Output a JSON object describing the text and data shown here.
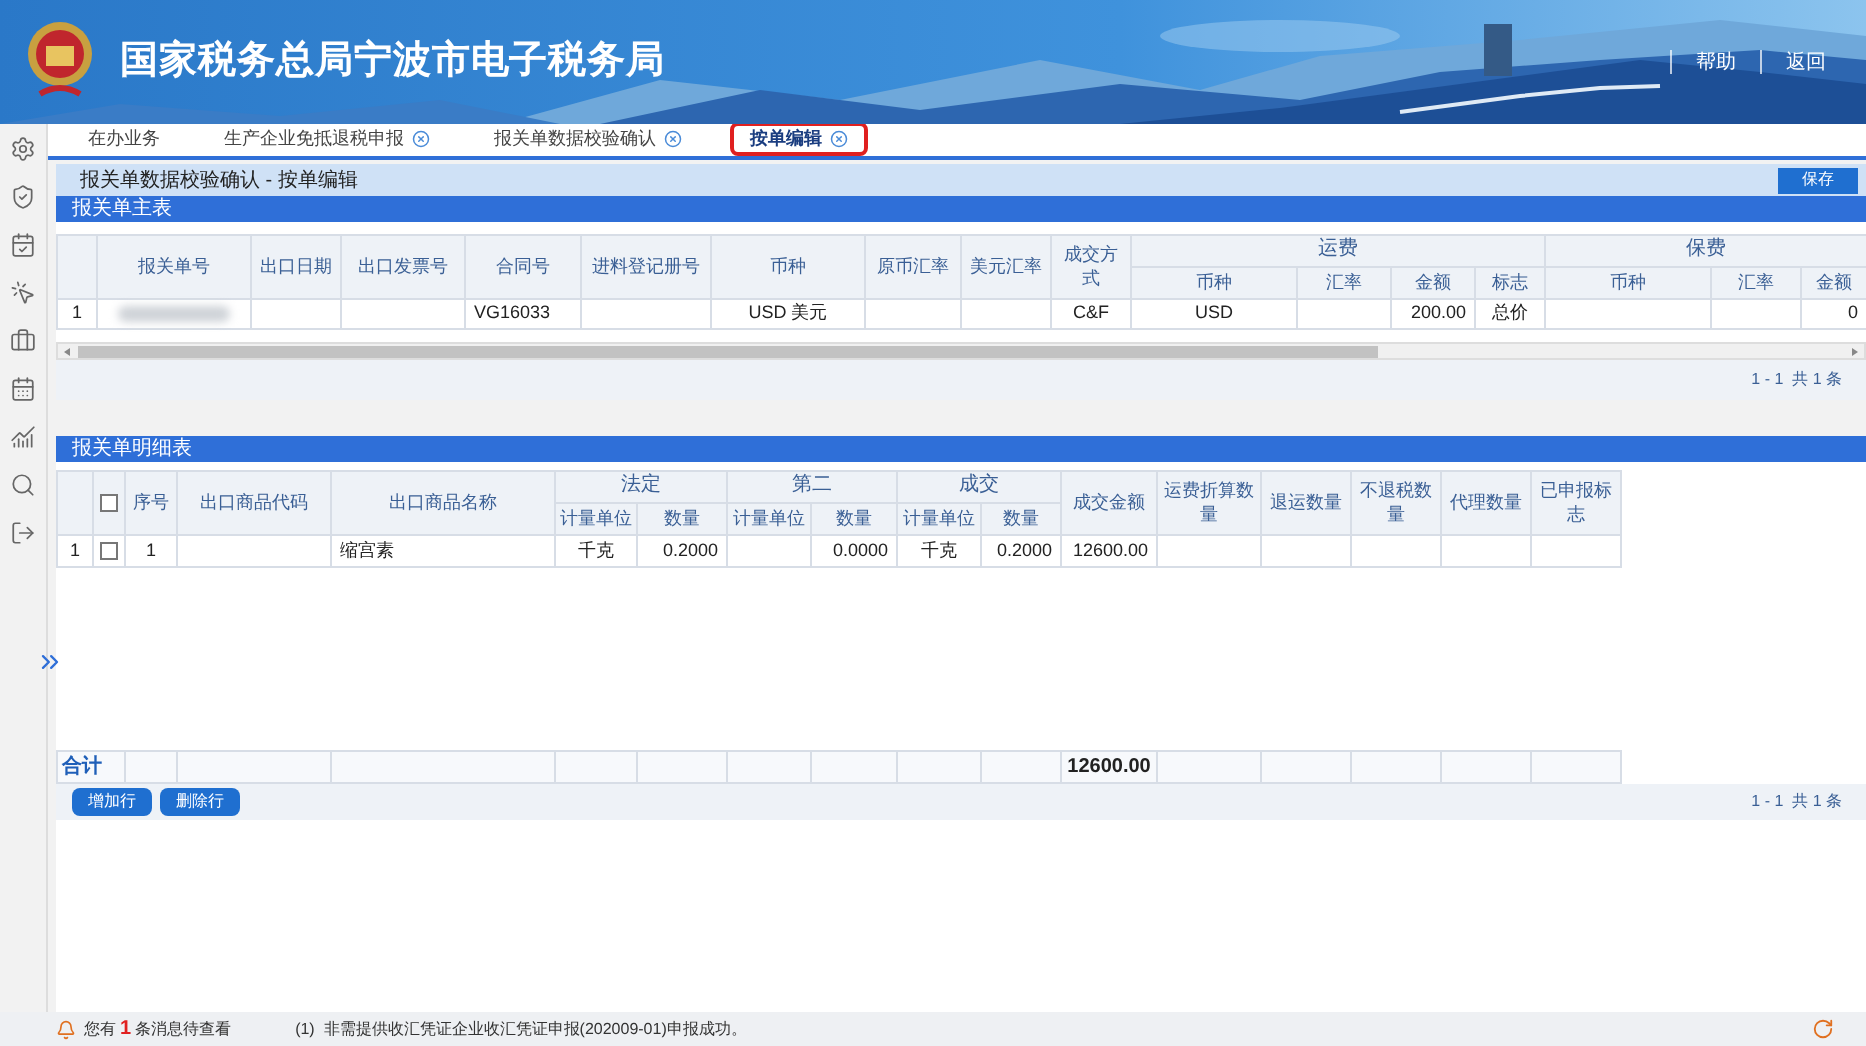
{
  "header": {
    "title": "国家税务总局宁波市电子税务局",
    "links": [
      "帮助",
      "返回"
    ]
  },
  "tabs": [
    {
      "label": "在办业务",
      "selected": false,
      "closable": false
    },
    {
      "label": "生产企业免抵退税申报",
      "selected": false,
      "closable": true
    },
    {
      "label": "报关单数据校验确认",
      "selected": false,
      "closable": true
    },
    {
      "label": "按单编辑",
      "selected": true,
      "closable": true
    }
  ],
  "page": {
    "title": "报关单数据校验确认 - 按单编辑",
    "save_button": "保存"
  },
  "main_table": {
    "title": "报关单主表",
    "columns": [
      {},
      {
        "label": "报关单号"
      },
      {
        "label": "出口日期"
      },
      {
        "label": "出口发票号"
      },
      {
        "label": "合同号"
      },
      {
        "label": "进料登记册号"
      },
      {
        "label": "币种"
      },
      {
        "label": "原币汇率"
      },
      {
        "label": "美元汇率"
      },
      {
        "label": "成交方式"
      },
      {
        "label": "运费",
        "colspan": 4,
        "children": [
          "币种",
          "汇率",
          "金额",
          "标志"
        ]
      },
      {
        "label": "保费",
        "colspan": 3,
        "children": [
          "币种",
          "汇率",
          "金额"
        ]
      }
    ],
    "rows": [
      {
        "cells": [
          "1",
          {
            "kind": "blurred"
          },
          "",
          "",
          "VG16033",
          "",
          "USD 美元",
          "",
          "",
          "C&F",
          "USD",
          "",
          "200.00",
          "总价",
          "",
          "",
          "0"
        ]
      }
    ],
    "pager": "1 - 1  共 1 条"
  },
  "detail_table": {
    "title": "报关单明细表",
    "columns": [
      {},
      {
        "kind": "checkbox",
        "checked": false
      },
      {
        "label": "序号"
      },
      {
        "label": "出口商品代码"
      },
      {
        "label": "出口商品名称"
      },
      {
        "label": "法定",
        "colspan": 2,
        "children": [
          "计量单位",
          "数量"
        ]
      },
      {
        "label": "第二",
        "colspan": 2,
        "children": [
          "计量单位",
          "数量"
        ]
      },
      {
        "label": "成交",
        "colspan": 2,
        "children": [
          "计量单位",
          "数量"
        ]
      },
      {
        "label": "成交金额"
      },
      {
        "label": "运费折算数量"
      },
      {
        "label": "退运数量"
      },
      {
        "label": "不退税数量"
      },
      {
        "label": "代理数量"
      },
      {
        "label": "已申报标志"
      }
    ],
    "rows": [
      {
        "cells": [
          "1",
          {
            "kind": "checkbox",
            "checked": false
          },
          "1",
          "",
          "缩宫素",
          "千克",
          "0.2000",
          "",
          "0.0000",
          "千克",
          "0.2000",
          "12600.00",
          "",
          "",
          "",
          "",
          ""
        ]
      }
    ],
    "total": {
      "label": "合计",
      "cells": [
        null,
        null,
        null,
        null,
        null,
        null,
        null,
        null,
        null,
        "12600.00",
        null,
        null,
        null,
        null,
        null
      ]
    },
    "buttons": [
      "增加行",
      "删除行"
    ],
    "pager": "1 - 1  共 1 条"
  },
  "status_bar": {
    "prefix": "您有",
    "count": "1",
    "suffix": "条消息待查看",
    "message": "(1)  非需提供收汇凭证企业收汇凭证申报(202009-01)申报成功。"
  }
}
